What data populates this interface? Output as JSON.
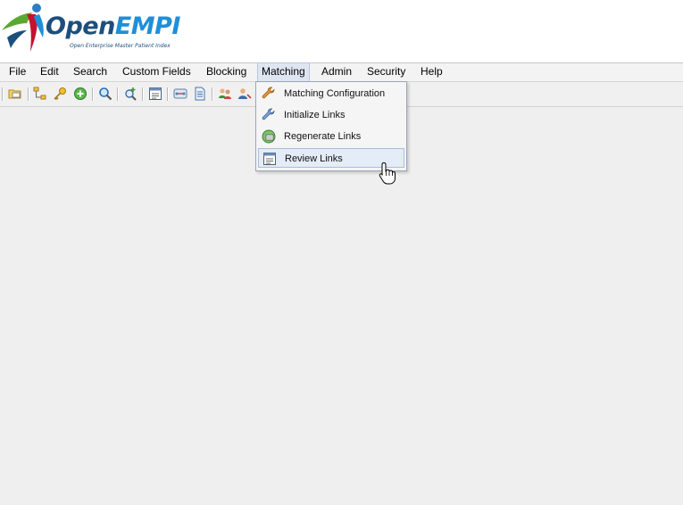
{
  "brand": {
    "name_part1": "Open",
    "name_part2": "EMPI",
    "tagline": "Open Enterprise Master Patient Index"
  },
  "menubar": {
    "items": [
      {
        "label": "File"
      },
      {
        "label": "Edit"
      },
      {
        "label": "Search"
      },
      {
        "label": "Custom Fields"
      },
      {
        "label": "Blocking"
      },
      {
        "label": "Matching",
        "active": true
      },
      {
        "label": "Admin"
      },
      {
        "label": "Security"
      },
      {
        "label": "Help"
      }
    ]
  },
  "toolbar": {
    "icons": [
      "open-folder-icon",
      "hierarchy-icon",
      "key-icon",
      "add-circle-icon",
      "magnifier-icon",
      "search-plus-icon",
      "form-icon",
      "link-review-icon",
      "document-icon",
      "users-icon",
      "user-link-icon"
    ]
  },
  "matching_menu": {
    "items": [
      {
        "label": "Matching Configuration",
        "icon": "wrench-icon"
      },
      {
        "label": "Initialize Links",
        "icon": "wrench-blue-icon"
      },
      {
        "label": "Regenerate Links",
        "icon": "regenerate-icon"
      },
      {
        "label": "Review Links",
        "icon": "review-icon",
        "hover": true
      }
    ]
  },
  "colors": {
    "brand_dark": "#1d4f7c",
    "brand_accent": "#1e8fd8",
    "menu_hover": "#e4ecf8"
  }
}
